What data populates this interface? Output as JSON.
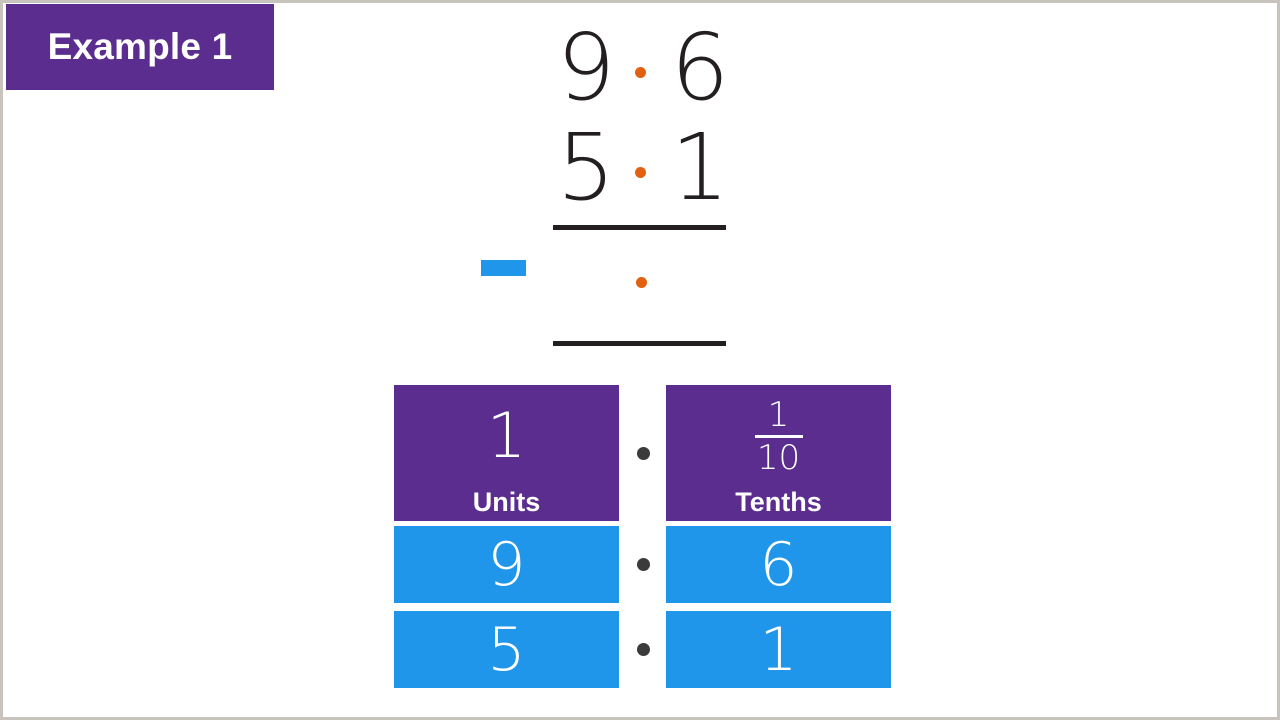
{
  "page": {
    "background_color": "#ffffff",
    "border_color": "#c9c3bd"
  },
  "badge": {
    "label": "Example 1",
    "background_color": "#5b2d8e",
    "text_color": "#ffffff"
  },
  "colors": {
    "purple": "#5b2d8e",
    "blue": "#1f96ea",
    "orange": "#e2600f",
    "dark": "#231f20",
    "dot_gray": "#3b3b3b"
  },
  "sum": {
    "operator": "minus",
    "minuend": {
      "units": "9",
      "tenths": "6"
    },
    "subtrahend": {
      "units": "5",
      "tenths": "1"
    },
    "answer": {
      "units": "",
      "tenths": ""
    },
    "decimal_point": "•",
    "minuend_text": "9·6",
    "subtrahend_text": "5·1",
    "answer_text": "·"
  },
  "place_value_table": {
    "separator_dot": "•",
    "columns": [
      {
        "name": "units",
        "header_symbol_type": "whole",
        "header_symbol": "1",
        "header_label": "Units",
        "cells": [
          "9",
          "5"
        ]
      },
      {
        "name": "tenths",
        "header_symbol_type": "fraction",
        "header_numerator": "1",
        "header_denominator": "10",
        "header_label": "Tenths",
        "cells": [
          "6",
          "1"
        ]
      }
    ]
  }
}
